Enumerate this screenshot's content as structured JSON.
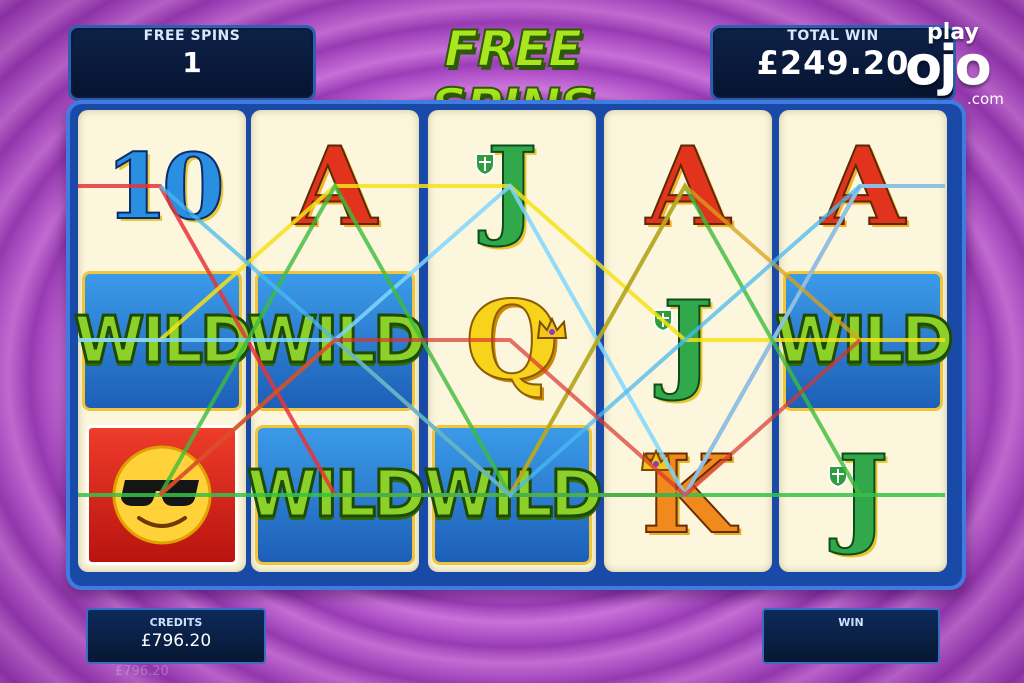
{
  "header": {
    "free_spins_label": "FREE SPINS",
    "free_spins_value": "1",
    "title": "FREE SPINS",
    "total_win_label": "TOTAL WIN",
    "total_win_value": "£249.20"
  },
  "logo": {
    "play": "play",
    "ojo": "ojo",
    "com": ".com"
  },
  "reels": [
    [
      "10",
      "WILD",
      "smiley"
    ],
    [
      "A",
      "WILD",
      "WILD"
    ],
    [
      "J",
      "Q",
      "WILD"
    ],
    [
      "A",
      "J",
      "K"
    ],
    [
      "A",
      "WILD",
      "J"
    ]
  ],
  "footer": {
    "credits_label": "CREDITS",
    "credits_value": "£796.20",
    "credits_ghost": "£796.20",
    "win_label": "WIN",
    "win_value": ""
  },
  "colors": {
    "background": "#b958d2",
    "reel_frame": "#1a4aa8",
    "reel_bg": "#fbf6dc",
    "title_green": "#a8e61e",
    "panel": "#0d2148"
  },
  "icons": [
    "crown-icon",
    "shield-icon",
    "sunglasses-smiley-icon"
  ]
}
